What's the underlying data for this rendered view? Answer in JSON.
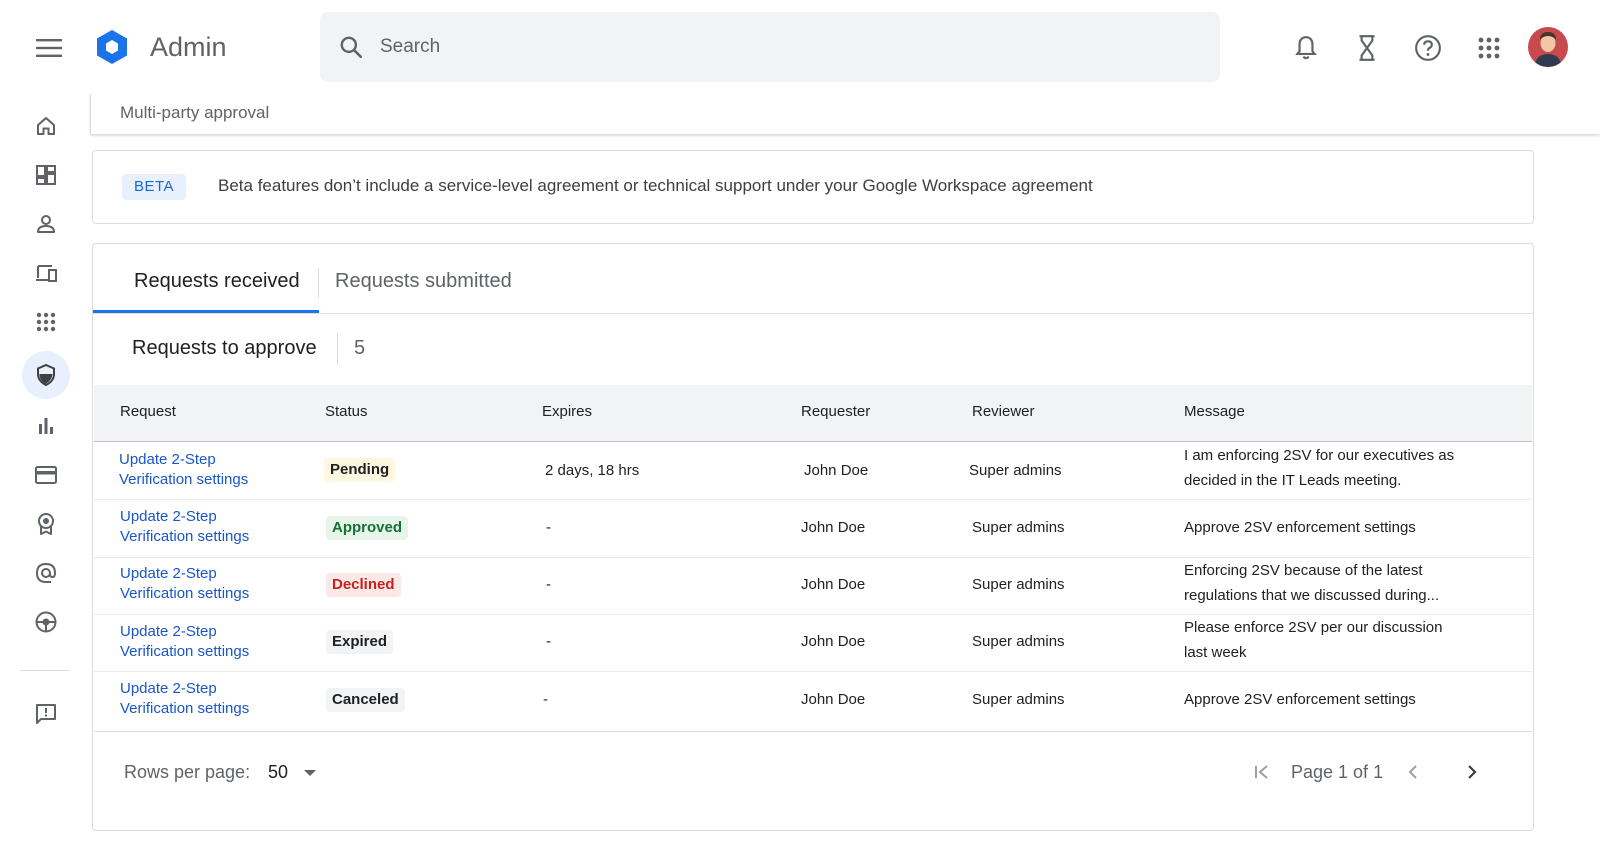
{
  "header": {
    "app_title": "Admin",
    "search_placeholder": "Search",
    "icons": [
      "menu-icon",
      "admin-logo-icon",
      "search-icon",
      "notifications-icon",
      "hourglass-icon",
      "help-icon",
      "apps-grid-icon",
      "avatar"
    ]
  },
  "sidebar": {
    "items": [
      {
        "icon": "home-icon"
      },
      {
        "icon": "dashboard-icon"
      },
      {
        "icon": "user-icon"
      },
      {
        "icon": "devices-icon"
      },
      {
        "icon": "apps-icon"
      },
      {
        "icon": "security-shield-icon",
        "active": true
      },
      {
        "icon": "reports-icon"
      },
      {
        "icon": "billing-icon"
      },
      {
        "icon": "account-badge-icon"
      },
      {
        "icon": "email-at-icon"
      },
      {
        "icon": "rules-icon"
      },
      {
        "icon": "feedback-icon"
      }
    ]
  },
  "breadcrumb": "Multi-party approval",
  "beta": {
    "badge": "BETA",
    "text": "Beta features don’t include a service-level agreement or technical support under your Google Workspace agreement"
  },
  "tabs": [
    {
      "label": "Requests received",
      "active": true
    },
    {
      "label": "Requests submitted",
      "active": false
    }
  ],
  "section": {
    "title": "Requests to approve",
    "count": "5"
  },
  "table": {
    "columns": [
      "Request",
      "Status",
      "Expires",
      "Requester",
      "Reviewer",
      "Message"
    ],
    "rows": [
      {
        "request_line1": "Update 2-Step",
        "request_line2": "Verification settings",
        "status": "Pending",
        "expires": "2 days, 18 hrs",
        "requester": "John Doe",
        "reviewer": "Super admins",
        "message_line1": "I am enforcing 2SV for our executives as",
        "message_line2": "decided in the IT Leads meeting."
      },
      {
        "request_line1": "Update 2-Step",
        "request_line2": "Verification settings",
        "status": "Approved",
        "expires": "-",
        "requester": "John Doe",
        "reviewer": "Super admins",
        "message_line1": "Approve 2SV enforcement settings",
        "message_line2": ""
      },
      {
        "request_line1": "Update 2-Step",
        "request_line2": "Verification settings",
        "status": "Declined",
        "expires": "-",
        "requester": "John Doe",
        "reviewer": "Super admins",
        "message_line1": "Enforcing 2SV because of the latest",
        "message_line2": "regulations that we discussed during..."
      },
      {
        "request_line1": "Update 2-Step",
        "request_line2": "Verification settings",
        "status": "Expired",
        "expires": "-",
        "requester": "John Doe",
        "reviewer": "Super admins",
        "message_line1": "Please enforce 2SV per our discussion",
        "message_line2": "last week"
      },
      {
        "request_line1": "Update 2-Step",
        "request_line2": "Verification settings",
        "status": "Canceled",
        "expires": "-",
        "requester": "John Doe",
        "reviewer": "Super admins",
        "message_line1": "Approve 2SV enforcement settings",
        "message_line2": ""
      }
    ]
  },
  "footer": {
    "rows_per_page_label": "Rows per page:",
    "rows_per_page_value": "50",
    "page_label": "Page 1 of 1"
  },
  "colors": {
    "accent": "#1a73e8",
    "link": "#1a55c9",
    "approved": "#137333",
    "declined": "#c5221f",
    "pending_bg": "#fef7e0"
  }
}
